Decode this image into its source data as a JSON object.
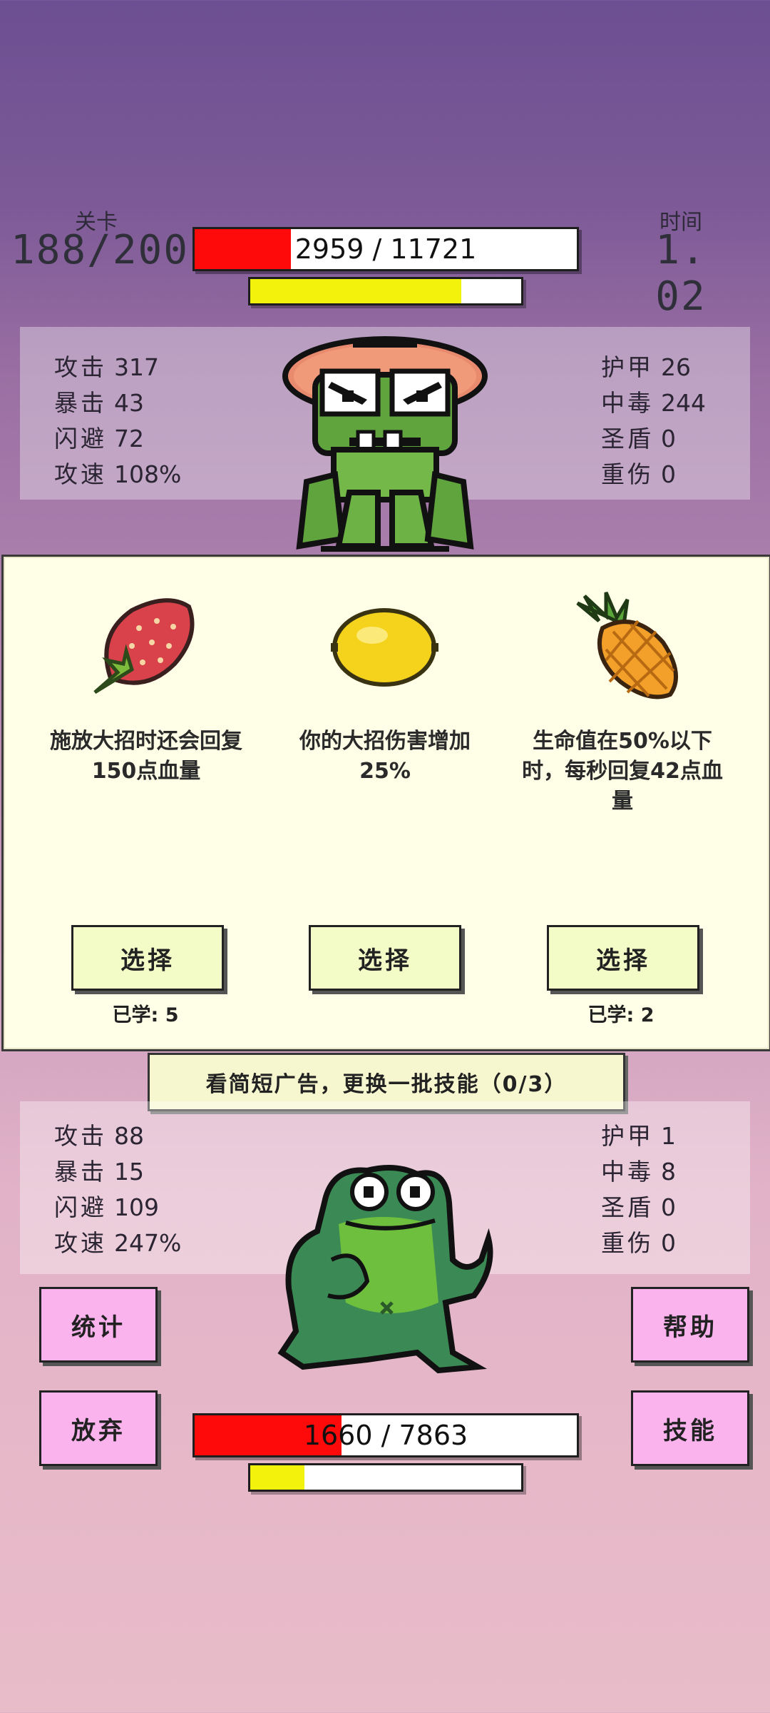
{
  "header": {
    "level_label": "关卡",
    "level_value": "188/200",
    "time_label": "时间",
    "time_value": "1. 02"
  },
  "enemy": {
    "hp_text": "2959  /  11721",
    "hp_fraction": 0.2525,
    "energy_fraction": 0.78,
    "stats_left": [
      {
        "label": "攻击",
        "value": "317"
      },
      {
        "label": "暴击",
        "value": "43"
      },
      {
        "label": "闪避",
        "value": "72"
      },
      {
        "label": "攻速",
        "value": "108%"
      }
    ],
    "stats_right": [
      {
        "label": "护甲",
        "value": "26"
      },
      {
        "label": "中毒",
        "value": "244"
      },
      {
        "label": "圣盾",
        "value": "0"
      },
      {
        "label": "重伤",
        "value": "0"
      }
    ],
    "sprite": "frog-mushroom-hat-enemy"
  },
  "choices": [
    {
      "icon": "strawberry-icon",
      "desc": "施放大招时还会回复150点血量",
      "button": "选择",
      "learned": "已学: 5"
    },
    {
      "icon": "lemon-icon",
      "desc": "你的大招伤害增加25%",
      "button": "选择",
      "learned": ""
    },
    {
      "icon": "pineapple-icon",
      "desc": "生命值在50%以下时，每秒回复42点血量",
      "button": "选择",
      "learned": "已学: 2"
    }
  ],
  "ad_button": "看简短广告，更换一批技能（0/3）",
  "player": {
    "stats_left": [
      {
        "label": "攻击",
        "value": "88"
      },
      {
        "label": "暴击",
        "value": "15"
      },
      {
        "label": "闪避",
        "value": "109"
      },
      {
        "label": "攻速",
        "value": "247%"
      }
    ],
    "stats_right": [
      {
        "label": "护甲",
        "value": "1"
      },
      {
        "label": "中毒",
        "value": "8"
      },
      {
        "label": "圣盾",
        "value": "0"
      },
      {
        "label": "重伤",
        "value": "0"
      }
    ],
    "hp_text": "1660  /  7863",
    "hp_fraction": 0.3839,
    "energy_fraction": 0.2,
    "sprite": "frog-player"
  },
  "buttons": {
    "stats": "统计",
    "help": "帮助",
    "give_up": "放弃",
    "skills": "技能"
  },
  "colors": {
    "hp_fill": "#ff0a0a",
    "energy_fill": "#f2f20c",
    "select_button": "#f3fbc7",
    "side_button": "#fbb3ee",
    "card_panel": "#fffee6"
  }
}
